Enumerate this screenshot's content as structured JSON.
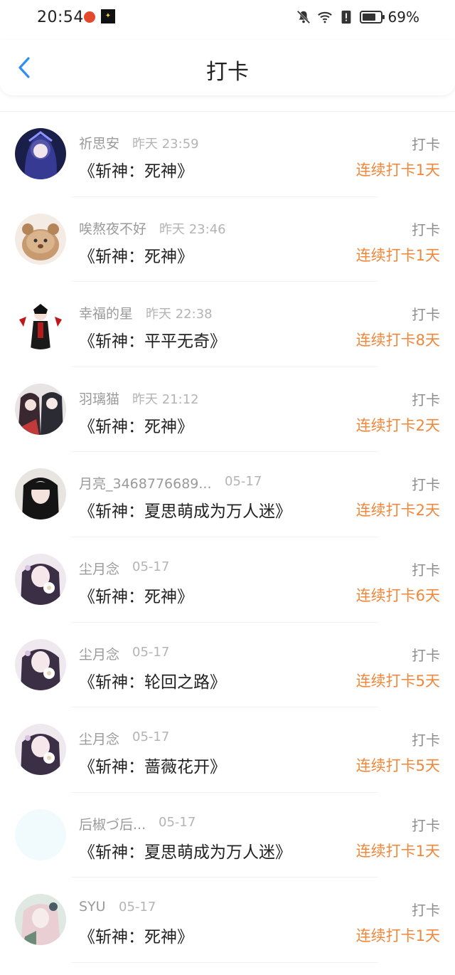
{
  "status_bar": {
    "time": "20:54",
    "battery": "69%",
    "icons": [
      "mute-bell-icon",
      "wifi-icon",
      "alert-icon",
      "battery-icon"
    ]
  },
  "header": {
    "title": "打卡"
  },
  "colors": {
    "accent": "#2f8ff0",
    "streak": "#f0873a"
  },
  "list": {
    "items": [
      {
        "name": "祈思安",
        "time": "昨天 23:59",
        "book": "《斩神：死神》",
        "action": "打卡",
        "streak": "连续打卡1天",
        "avatar": "anime-girl-blue"
      },
      {
        "name": "唉熬夜不好",
        "time": "昨天 23:46",
        "book": "《斩神：死神》",
        "action": "打卡",
        "streak": "连续打卡1天",
        "avatar": "cute-bear"
      },
      {
        "name": "幸福的星",
        "time": "昨天 22:38",
        "book": "《斩神：平平无奇》",
        "action": "打卡",
        "streak": "连续打卡8天",
        "avatar": "dark-character"
      },
      {
        "name": "羽璃猫",
        "time": "昨天 21:12",
        "book": "《斩神：死神》",
        "action": "打卡",
        "streak": "连续打卡2天",
        "avatar": "two-girls"
      },
      {
        "name": "月亮_3468776689...",
        "time": "05-17",
        "book": "《斩神：夏思萌成为万人迷》",
        "action": "打卡",
        "streak": "连续打卡2天",
        "avatar": "girl-photo"
      },
      {
        "name": "尘月念",
        "time": "05-17",
        "book": "《斩神：死神》",
        "action": "打卡",
        "streak": "连续打卡6天",
        "avatar": "girl-flower"
      },
      {
        "name": "尘月念",
        "time": "05-17",
        "book": "《斩神：轮回之路》",
        "action": "打卡",
        "streak": "连续打卡5天",
        "avatar": "girl-flower"
      },
      {
        "name": "尘月念",
        "time": "05-17",
        "book": "《斩神：蔷薇花开》",
        "action": "打卡",
        "streak": "连续打卡5天",
        "avatar": "girl-flower"
      },
      {
        "name": "后椒づ后...",
        "time": "05-17",
        "book": "《斩神：夏思萌成为万人迷》",
        "action": "打卡",
        "streak": "连续打卡1天",
        "avatar": "blank"
      },
      {
        "name": "SYU",
        "time": "05-17",
        "book": "《斩神：死神》",
        "action": "打卡",
        "streak": "连续打卡1天",
        "avatar": "girl-pink"
      }
    ]
  }
}
